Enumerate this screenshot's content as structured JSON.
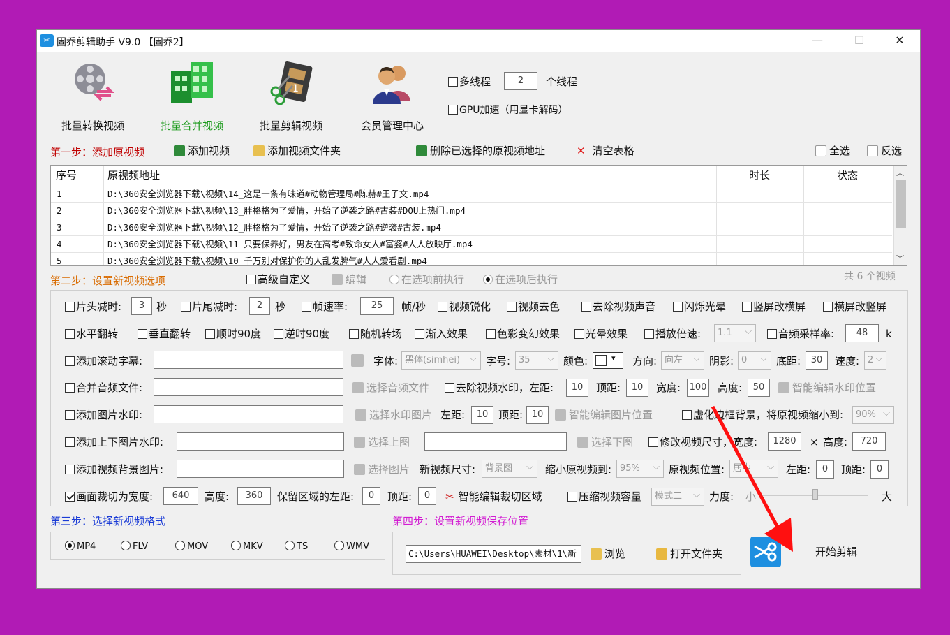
{
  "window": {
    "title": "固乔剪辑助手 V9.0 【固乔2】",
    "logo": "scissors-logo",
    "controls": [
      "minimize",
      "maximize",
      "close"
    ]
  },
  "toolbar": {
    "items": [
      {
        "label": "批量转换视频",
        "icon": "film-convert-icon",
        "active": false
      },
      {
        "label": "批量合并视频",
        "icon": "merge-grid-icon",
        "active": true
      },
      {
        "label": "批量剪辑视频",
        "icon": "film-cut-icon",
        "active": false
      },
      {
        "label": "会员管理中心",
        "icon": "members-icon",
        "active": false
      }
    ],
    "multithread_label": "多线程",
    "thread_count": "2",
    "thread_unit": "个线程",
    "gpu_label": "GPU加速（用显卡解码）"
  },
  "step1": {
    "title": "第一步：添加原视频",
    "add_video": "添加视频",
    "add_folder": "添加视频文件夹",
    "delete_selected": "删除已选择的原视频地址",
    "clear_table": "清空表格",
    "select_all": "全选",
    "invert": "反选"
  },
  "table": {
    "headers": {
      "index": "序号",
      "path": "原视频地址",
      "duration": "时长",
      "status": "状态"
    },
    "rows": [
      {
        "index": "1",
        "path": "D:\\360安全浏览器下载\\视频\\14_这是一条有味道#动物管理局#陈赫#王子文.mp4"
      },
      {
        "index": "2",
        "path": "D:\\360安全浏览器下载\\视频\\13_胖格格为了爱情，开始了逆袭之路#古装#DOU上热门.mp4"
      },
      {
        "index": "3",
        "path": "D:\\360安全浏览器下载\\视频\\12_胖格格为了爱情，开始了逆袭之路#逆袭#古装.mp4"
      },
      {
        "index": "4",
        "path": "D:\\360安全浏览器下载\\视频\\11_只要保养好，男友在高考#致命女人#富婆#人人放映厅.mp4"
      },
      {
        "index": "5",
        "path": "D:\\360安全浏览器下载\\视频\\10_千万别对保护你的人乱发脾气#人人爱看剧.mp4"
      }
    ],
    "count_text": "共 6 个视频"
  },
  "step2": {
    "title": "第二步：设置新视频选项",
    "advanced": "高级自定义",
    "edit": "编辑",
    "before": "在选项前执行",
    "after": "在选项后执行",
    "r1": {
      "head_cut": "片头减时:",
      "head_val": "3",
      "sec": "秒",
      "tail_cut": "片尾减时:",
      "tail_val": "2",
      "sec2": "秒",
      "fps": "帧速率:",
      "fps_val": "25",
      "fps_unit": "帧/秒",
      "sharpen": "视频锐化",
      "decolor": "视频去色",
      "mute": "去除视频声音",
      "flash": "闪烁光晕",
      "v2h": "竖屏改横屏",
      "h2v": "横屏改竖屏"
    },
    "r2": {
      "hflip": "水平翻转",
      "vflip": "垂直翻转",
      "cw": "顺时90度",
      "ccw": "逆时90度",
      "random": "随机转场",
      "fadein": "渐入效果",
      "color": "色彩变幻效果",
      "halo": "光晕效果",
      "speed": "播放倍速:",
      "speed_val": "1.1",
      "sample": "音频采样率:",
      "sample_val": "48",
      "k": "k"
    },
    "r3": {
      "subtitle": "添加滚动字幕:",
      "font": "字体:",
      "font_val": "黑体(simhei)",
      "size": "字号:",
      "size_val": "35",
      "color": "颜色:",
      "dir": "方向:",
      "dir_val": "向左",
      "shadow": "阴影:",
      "shadow_val": "0",
      "bottom": "底距:",
      "bottom_val": "30",
      "speed": "速度:",
      "speed_val": "2"
    },
    "r4": {
      "audio": "合并音频文件:",
      "choose_audio": "选择音频文件",
      "remove_wm": "去除视频水印，左距:",
      "left_val": "10",
      "top": "顶距:",
      "top_val": "10",
      "width": "宽度:",
      "width_val": "100",
      "height": "高度:",
      "height_val": "50",
      "smart_wm": "智能编辑水印位置"
    },
    "r5": {
      "img_wm": "添加图片水印:",
      "choose_wm": "选择水印图片",
      "left": "左距:",
      "left_val": "10",
      "top": "顶距:",
      "top_val": "10",
      "smart_img": "智能编辑图片位置",
      "blur_bg": "虚化边框背景，将原视频缩小到:",
      "blur_val": "90%"
    },
    "r6": {
      "updown": "添加上下图片水印:",
      "choose_up": "选择上图",
      "choose_down": "选择下图",
      "resize": "修改视频尺寸，宽度:",
      "w_val": "1280",
      "x": "×",
      "h": "高度:",
      "h_val": "720"
    },
    "r7": {
      "bg": "添加视频背景图片:",
      "choose_img": "选择图片",
      "new_size": "新视频尺寸:",
      "new_size_val": "背景图",
      "shrink": "缩小原视频到:",
      "shrink_val": "95%",
      "pos": "原视频位置:",
      "pos_val": "居中",
      "left": "左距:",
      "left_val": "0",
      "top": "顶距:",
      "top_val": "0"
    },
    "r8": {
      "crop": "画面裁切为宽度:",
      "crop_w": "640",
      "crop_h_label": "高度:",
      "crop_h": "360",
      "keep_left": "保留区域的左距:",
      "keep_left_val": "0",
      "keep_top": "顶距:",
      "keep_top_val": "0",
      "smart_crop": "智能编辑裁切区域",
      "compress": "压缩视频容量",
      "mode": "模式二",
      "strength": "力度:",
      "small": "小",
      "big": "大"
    }
  },
  "step3": {
    "title": "第三步：选择新视频格式",
    "formats": [
      "MP4",
      "FLV",
      "MOV",
      "MKV",
      "TS",
      "WMV"
    ],
    "selected": "MP4"
  },
  "step4": {
    "title": "第四步：设置新视频保存位置",
    "path": "C:\\Users\\HUAWEI\\Desktop\\素材\\1\\新",
    "browse": "浏览",
    "open_folder": "打开文件夹",
    "start": "开始剪辑"
  },
  "colors": {
    "background": "#b11bb5",
    "step1": "#c00000",
    "step2": "#d96b00",
    "step3": "#1a3bd6",
    "step4": "#d21ed2",
    "arrow": "#ff1010",
    "active_tool": "#1a9a1a"
  }
}
